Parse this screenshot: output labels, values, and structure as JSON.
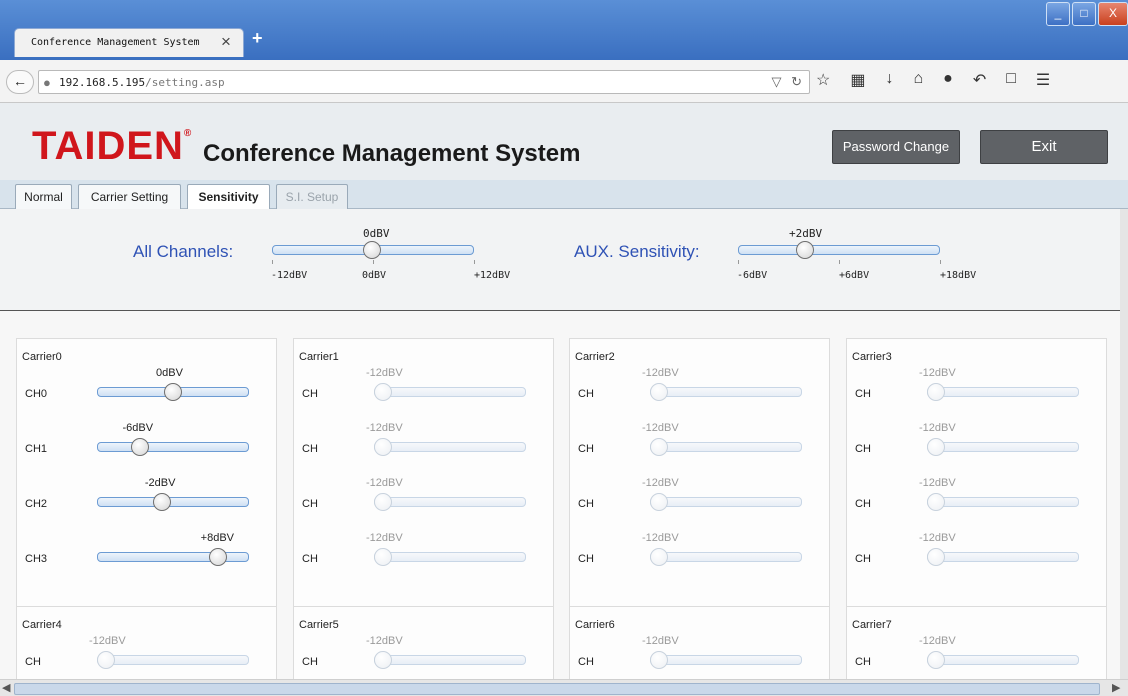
{
  "browser": {
    "tab_title": "Conference Management System",
    "tab_close": "×",
    "new_tab": "+",
    "url_host": "192.168.5.195",
    "url_path": "/setting.asp",
    "window_buttons": [
      "_",
      "□",
      "X"
    ]
  },
  "header": {
    "logo": "TAIDEN",
    "logo_mark": "®",
    "app_title": "Conference Management System",
    "password_button": "Password Change",
    "exit_button": "Exit"
  },
  "tabs": [
    {
      "label": "Normal",
      "state": "normal"
    },
    {
      "label": "Carrier Setting",
      "state": "normal"
    },
    {
      "label": "Sensitivity",
      "state": "active"
    },
    {
      "label": "S.I. Setup",
      "state": "disabled"
    }
  ],
  "global": {
    "all_channels": {
      "label": "All Channels:",
      "value": "0dBV",
      "position": 0.5,
      "ticks": [
        "-12dBV",
        "0dBV",
        "+12dBV"
      ]
    },
    "aux": {
      "label": "AUX. Sensitivity:",
      "value": "+2dBV",
      "position": 0.333,
      "ticks": [
        "-6dBV",
        "+6dBV",
        "+18dBV"
      ]
    }
  },
  "carriers": [
    {
      "name": "Carrier0",
      "channels": [
        {
          "label": "CH0",
          "value": "0dBV",
          "position": 0.5,
          "enabled": true
        },
        {
          "label": "CH1",
          "value": "-6dBV",
          "position": 0.25,
          "enabled": true
        },
        {
          "label": "CH2",
          "value": "-2dBV",
          "position": 0.4167,
          "enabled": true
        },
        {
          "label": "CH3",
          "value": "+8dBV",
          "position": 0.8333,
          "enabled": true
        }
      ]
    },
    {
      "name": "Carrier1",
      "channels": [
        {
          "label": "CH",
          "value": "-12dBV",
          "position": 0,
          "enabled": false
        },
        {
          "label": "CH",
          "value": "-12dBV",
          "position": 0,
          "enabled": false
        },
        {
          "label": "CH",
          "value": "-12dBV",
          "position": 0,
          "enabled": false
        },
        {
          "label": "CH",
          "value": "-12dBV",
          "position": 0,
          "enabled": false
        }
      ]
    },
    {
      "name": "Carrier2",
      "channels": [
        {
          "label": "CH",
          "value": "-12dBV",
          "position": 0,
          "enabled": false
        },
        {
          "label": "CH",
          "value": "-12dBV",
          "position": 0,
          "enabled": false
        },
        {
          "label": "CH",
          "value": "-12dBV",
          "position": 0,
          "enabled": false
        },
        {
          "label": "CH",
          "value": "-12dBV",
          "position": 0,
          "enabled": false
        }
      ]
    },
    {
      "name": "Carrier3",
      "channels": [
        {
          "label": "CH",
          "value": "-12dBV",
          "position": 0,
          "enabled": false
        },
        {
          "label": "CH",
          "value": "-12dBV",
          "position": 0,
          "enabled": false
        },
        {
          "label": "CH",
          "value": "-12dBV",
          "position": 0,
          "enabled": false
        },
        {
          "label": "CH",
          "value": "-12dBV",
          "position": 0,
          "enabled": false
        }
      ]
    },
    {
      "name": "Carrier4",
      "channels": [
        {
          "label": "CH",
          "value": "-12dBV",
          "position": 0,
          "enabled": false
        }
      ]
    },
    {
      "name": "Carrier5",
      "channels": [
        {
          "label": "CH",
          "value": "-12dBV",
          "position": 0,
          "enabled": false
        }
      ]
    },
    {
      "name": "Carrier6",
      "channels": [
        {
          "label": "CH",
          "value": "-12dBV",
          "position": 0,
          "enabled": false
        }
      ]
    },
    {
      "name": "Carrier7",
      "channels": [
        {
          "label": "CH",
          "value": "-12dBV",
          "position": 0,
          "enabled": false
        }
      ]
    }
  ]
}
